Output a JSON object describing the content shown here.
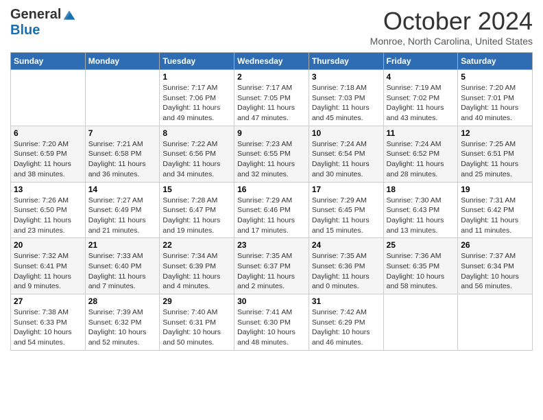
{
  "logo": {
    "general": "General",
    "blue": "Blue"
  },
  "header": {
    "month": "October 2024",
    "location": "Monroe, North Carolina, United States"
  },
  "weekdays": [
    "Sunday",
    "Monday",
    "Tuesday",
    "Wednesday",
    "Thursday",
    "Friday",
    "Saturday"
  ],
  "weeks": [
    [
      {
        "day": "",
        "info": ""
      },
      {
        "day": "",
        "info": ""
      },
      {
        "day": "1",
        "info": "Sunrise: 7:17 AM\nSunset: 7:06 PM\nDaylight: 11 hours and 49 minutes."
      },
      {
        "day": "2",
        "info": "Sunrise: 7:17 AM\nSunset: 7:05 PM\nDaylight: 11 hours and 47 minutes."
      },
      {
        "day": "3",
        "info": "Sunrise: 7:18 AM\nSunset: 7:03 PM\nDaylight: 11 hours and 45 minutes."
      },
      {
        "day": "4",
        "info": "Sunrise: 7:19 AM\nSunset: 7:02 PM\nDaylight: 11 hours and 43 minutes."
      },
      {
        "day": "5",
        "info": "Sunrise: 7:20 AM\nSunset: 7:01 PM\nDaylight: 11 hours and 40 minutes."
      }
    ],
    [
      {
        "day": "6",
        "info": "Sunrise: 7:20 AM\nSunset: 6:59 PM\nDaylight: 11 hours and 38 minutes."
      },
      {
        "day": "7",
        "info": "Sunrise: 7:21 AM\nSunset: 6:58 PM\nDaylight: 11 hours and 36 minutes."
      },
      {
        "day": "8",
        "info": "Sunrise: 7:22 AM\nSunset: 6:56 PM\nDaylight: 11 hours and 34 minutes."
      },
      {
        "day": "9",
        "info": "Sunrise: 7:23 AM\nSunset: 6:55 PM\nDaylight: 11 hours and 32 minutes."
      },
      {
        "day": "10",
        "info": "Sunrise: 7:24 AM\nSunset: 6:54 PM\nDaylight: 11 hours and 30 minutes."
      },
      {
        "day": "11",
        "info": "Sunrise: 7:24 AM\nSunset: 6:52 PM\nDaylight: 11 hours and 28 minutes."
      },
      {
        "day": "12",
        "info": "Sunrise: 7:25 AM\nSunset: 6:51 PM\nDaylight: 11 hours and 25 minutes."
      }
    ],
    [
      {
        "day": "13",
        "info": "Sunrise: 7:26 AM\nSunset: 6:50 PM\nDaylight: 11 hours and 23 minutes."
      },
      {
        "day": "14",
        "info": "Sunrise: 7:27 AM\nSunset: 6:49 PM\nDaylight: 11 hours and 21 minutes."
      },
      {
        "day": "15",
        "info": "Sunrise: 7:28 AM\nSunset: 6:47 PM\nDaylight: 11 hours and 19 minutes."
      },
      {
        "day": "16",
        "info": "Sunrise: 7:29 AM\nSunset: 6:46 PM\nDaylight: 11 hours and 17 minutes."
      },
      {
        "day": "17",
        "info": "Sunrise: 7:29 AM\nSunset: 6:45 PM\nDaylight: 11 hours and 15 minutes."
      },
      {
        "day": "18",
        "info": "Sunrise: 7:30 AM\nSunset: 6:43 PM\nDaylight: 11 hours and 13 minutes."
      },
      {
        "day": "19",
        "info": "Sunrise: 7:31 AM\nSunset: 6:42 PM\nDaylight: 11 hours and 11 minutes."
      }
    ],
    [
      {
        "day": "20",
        "info": "Sunrise: 7:32 AM\nSunset: 6:41 PM\nDaylight: 11 hours and 9 minutes."
      },
      {
        "day": "21",
        "info": "Sunrise: 7:33 AM\nSunset: 6:40 PM\nDaylight: 11 hours and 7 minutes."
      },
      {
        "day": "22",
        "info": "Sunrise: 7:34 AM\nSunset: 6:39 PM\nDaylight: 11 hours and 4 minutes."
      },
      {
        "day": "23",
        "info": "Sunrise: 7:35 AM\nSunset: 6:37 PM\nDaylight: 11 hours and 2 minutes."
      },
      {
        "day": "24",
        "info": "Sunrise: 7:35 AM\nSunset: 6:36 PM\nDaylight: 11 hours and 0 minutes."
      },
      {
        "day": "25",
        "info": "Sunrise: 7:36 AM\nSunset: 6:35 PM\nDaylight: 10 hours and 58 minutes."
      },
      {
        "day": "26",
        "info": "Sunrise: 7:37 AM\nSunset: 6:34 PM\nDaylight: 10 hours and 56 minutes."
      }
    ],
    [
      {
        "day": "27",
        "info": "Sunrise: 7:38 AM\nSunset: 6:33 PM\nDaylight: 10 hours and 54 minutes."
      },
      {
        "day": "28",
        "info": "Sunrise: 7:39 AM\nSunset: 6:32 PM\nDaylight: 10 hours and 52 minutes."
      },
      {
        "day": "29",
        "info": "Sunrise: 7:40 AM\nSunset: 6:31 PM\nDaylight: 10 hours and 50 minutes."
      },
      {
        "day": "30",
        "info": "Sunrise: 7:41 AM\nSunset: 6:30 PM\nDaylight: 10 hours and 48 minutes."
      },
      {
        "day": "31",
        "info": "Sunrise: 7:42 AM\nSunset: 6:29 PM\nDaylight: 10 hours and 46 minutes."
      },
      {
        "day": "",
        "info": ""
      },
      {
        "day": "",
        "info": ""
      }
    ]
  ]
}
